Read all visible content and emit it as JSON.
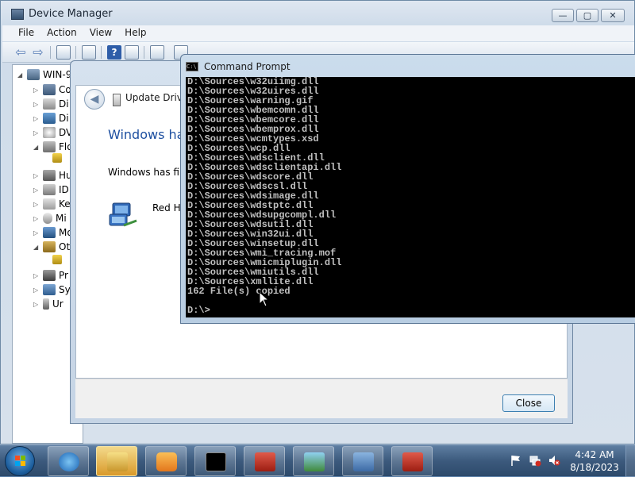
{
  "device_manager": {
    "title": "Device Manager",
    "window_buttons": {
      "minimize": "—",
      "maximize": "▢",
      "close": "✕"
    },
    "menu": [
      "File",
      "Action",
      "View",
      "Help"
    ],
    "tree": {
      "root": "WIN-9",
      "items": [
        {
          "label": "Co",
          "expander": "▷",
          "icon": "computer-icon"
        },
        {
          "label": "Di",
          "expander": "▷",
          "icon": "disk-drive-icon"
        },
        {
          "label": "Di",
          "expander": "▷",
          "icon": "display-adapter-icon"
        },
        {
          "label": "DV",
          "expander": "▷",
          "icon": "dvd-drive-icon"
        },
        {
          "label": "Flo",
          "expander": "◢",
          "icon": "floppy-controller-icon"
        },
        {
          "label": "Hu",
          "expander": "▷",
          "icon": "human-interface-icon"
        },
        {
          "label": "ID",
          "expander": "▷",
          "icon": "ide-controller-icon"
        },
        {
          "label": "Ke",
          "expander": "▷",
          "icon": "keyboard-icon"
        },
        {
          "label": "Mi",
          "expander": "▷",
          "icon": "mouse-icon"
        },
        {
          "label": "Mo",
          "expander": "▷",
          "icon": "monitor-icon"
        },
        {
          "label": "Ot",
          "expander": "◢",
          "icon": "other-devices-icon"
        },
        {
          "label": "Pr",
          "expander": "▷",
          "icon": "processor-icon"
        },
        {
          "label": "Sy",
          "expander": "▷",
          "icon": "system-devices-icon"
        },
        {
          "label": "Ur",
          "expander": "▷",
          "icon": "usb-controller-icon"
        }
      ]
    }
  },
  "update_driver": {
    "title": "Update Driver",
    "heading": "Windows has",
    "body": "Windows has finis",
    "device_name": "Red Ha",
    "close_label": "Close"
  },
  "command_prompt": {
    "title": "Command Prompt",
    "lines": [
      "D:\\Sources\\w32uiimg.dll",
      "D:\\Sources\\w32uires.dll",
      "D:\\Sources\\warning.gif",
      "D:\\Sources\\wbemcomn.dll",
      "D:\\Sources\\wbemcore.dll",
      "D:\\Sources\\wbemprox.dll",
      "D:\\Sources\\wcmtypes.xsd",
      "D:\\Sources\\wcp.dll",
      "D:\\Sources\\wdsclient.dll",
      "D:\\Sources\\wdsclientapi.dll",
      "D:\\Sources\\wdscore.dll",
      "D:\\Sources\\wdscsl.dll",
      "D:\\Sources\\wdsimage.dll",
      "D:\\Sources\\wdstptc.dll",
      "D:\\Sources\\wdsupgcompl.dll",
      "D:\\Sources\\wdsutil.dll",
      "D:\\Sources\\win32ui.dll",
      "D:\\Sources\\winsetup.dll",
      "D:\\Sources\\wmi_tracing.mof",
      "D:\\Sources\\wmicmiplugin.dll",
      "D:\\Sources\\wmiutils.dll",
      "D:\\Sources\\xmllite.dll",
      "162 File(s) copied"
    ],
    "prompt": "D:\\>"
  },
  "taskbar": {
    "apps": [
      {
        "name": "internet-explorer-icon"
      },
      {
        "name": "windows-explorer-icon",
        "active": true
      },
      {
        "name": "media-player-icon"
      },
      {
        "name": "command-prompt-icon"
      },
      {
        "name": "toolbox-icon"
      },
      {
        "name": "image-viewer-icon"
      },
      {
        "name": "device-manager-icon"
      },
      {
        "name": "toolbox-icon"
      }
    ],
    "clock": {
      "time": "4:42 AM",
      "date": "8/18/2023"
    }
  },
  "colors": {
    "cmd_background": "#000000",
    "cmd_text": "#c0c0c0",
    "heading_blue": "#1d4fa0",
    "taskbar": "#3c5a7d"
  }
}
